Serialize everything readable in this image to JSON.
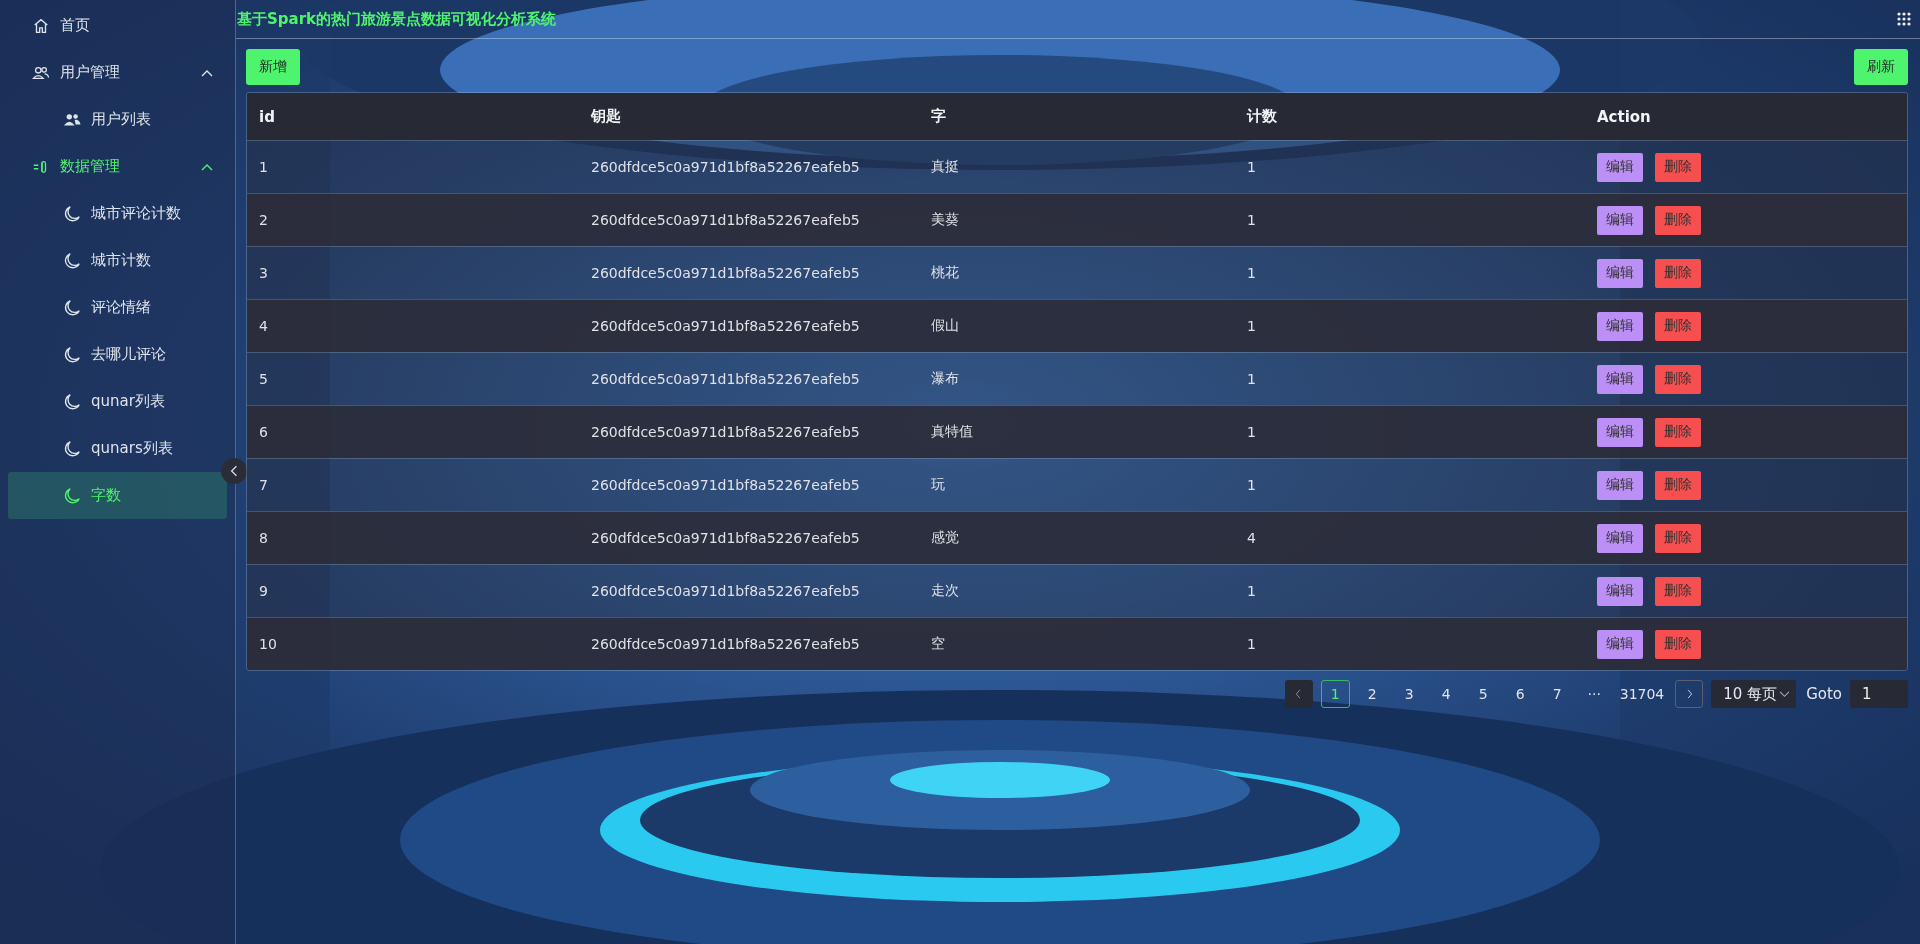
{
  "title": "基于Spark的热门旅游景点数据可视化分析系统",
  "sidebar": {
    "items": [
      {
        "kind": "link",
        "label": "首页",
        "selected": false
      },
      {
        "kind": "group",
        "label": "用户管理",
        "expanded": true,
        "selected": false,
        "children": [
          {
            "label": "用户列表",
            "selected": false
          }
        ]
      },
      {
        "kind": "group",
        "label": "数据管理",
        "expanded": true,
        "selected": true,
        "children": [
          {
            "label": "城市评论计数",
            "selected": false
          },
          {
            "label": "城市计数",
            "selected": false
          },
          {
            "label": "评论情绪",
            "selected": false
          },
          {
            "label": "去哪儿评论",
            "selected": false
          },
          {
            "label": "qunar列表",
            "selected": false
          },
          {
            "label": "qunars列表",
            "selected": false
          },
          {
            "label": "字数",
            "selected": true
          }
        ]
      }
    ]
  },
  "toolbar": {
    "add_button": "新增",
    "refresh_button": "刷新"
  },
  "table": {
    "columns": [
      "id",
      "钥匙",
      "字",
      "计数",
      "Action"
    ],
    "rows": [
      {
        "cells": [
          "1",
          "260dfdce5c0a971d1bf8a52267eafeb5",
          "真挺",
          "1"
        ],
        "actions": [
          {
            "kind": "edit",
            "label": "编辑"
          },
          {
            "kind": "delete",
            "label": "删除"
          }
        ]
      },
      {
        "cells": [
          "2",
          "260dfdce5c0a971d1bf8a52267eafeb5",
          "美葵",
          "1"
        ],
        "actions": [
          {
            "kind": "edit",
            "label": "编辑"
          },
          {
            "kind": "delete",
            "label": "删除"
          }
        ]
      },
      {
        "cells": [
          "3",
          "260dfdce5c0a971d1bf8a52267eafeb5",
          "桃花",
          "1"
        ],
        "actions": [
          {
            "kind": "edit",
            "label": "编辑"
          },
          {
            "kind": "delete",
            "label": "删除"
          }
        ]
      },
      {
        "cells": [
          "4",
          "260dfdce5c0a971d1bf8a52267eafeb5",
          "假山",
          "1"
        ],
        "actions": [
          {
            "kind": "edit",
            "label": "编辑"
          },
          {
            "kind": "delete",
            "label": "删除"
          }
        ]
      },
      {
        "cells": [
          "5",
          "260dfdce5c0a971d1bf8a52267eafeb5",
          "瀑布",
          "1"
        ],
        "actions": [
          {
            "kind": "edit",
            "label": "编辑"
          },
          {
            "kind": "delete",
            "label": "删除"
          }
        ]
      },
      {
        "cells": [
          "6",
          "260dfdce5c0a971d1bf8a52267eafeb5",
          "真特值",
          "1"
        ],
        "actions": [
          {
            "kind": "edit",
            "label": "编辑"
          },
          {
            "kind": "delete",
            "label": "删除"
          }
        ]
      },
      {
        "cells": [
          "7",
          "260dfdce5c0a971d1bf8a52267eafeb5",
          "玩",
          "1"
        ],
        "actions": [
          {
            "kind": "edit",
            "label": "编辑"
          },
          {
            "kind": "delete",
            "label": "删除"
          }
        ]
      },
      {
        "cells": [
          "8",
          "260dfdce5c0a971d1bf8a52267eafeb5",
          "感觉",
          "4"
        ],
        "actions": [
          {
            "kind": "edit",
            "label": "编辑"
          },
          {
            "kind": "delete",
            "label": "删除"
          }
        ]
      },
      {
        "cells": [
          "9",
          "260dfdce5c0a971d1bf8a52267eafeb5",
          "走次",
          "1"
        ],
        "actions": [
          {
            "kind": "edit",
            "label": "编辑"
          },
          {
            "kind": "delete",
            "label": "删除"
          }
        ]
      },
      {
        "cells": [
          "10",
          "260dfdce5c0a971d1bf8a52267eafeb5",
          "空",
          "1"
        ],
        "actions": [
          {
            "kind": "edit",
            "label": "编辑"
          },
          {
            "kind": "delete",
            "label": "删除"
          }
        ]
      }
    ]
  },
  "pagination": {
    "pages": [
      {
        "label": "1",
        "selected": true
      },
      {
        "label": "2",
        "selected": false
      },
      {
        "label": "3",
        "selected": false
      },
      {
        "label": "4",
        "selected": false
      },
      {
        "label": "5",
        "selected": false
      },
      {
        "label": "6",
        "selected": false
      },
      {
        "label": "7",
        "selected": false
      },
      {
        "label": "···",
        "selected": false
      },
      {
        "label": "31704",
        "selected": false
      }
    ],
    "page_size": "10 每页",
    "goto_label": "Goto",
    "goto_value": "1"
  }
}
